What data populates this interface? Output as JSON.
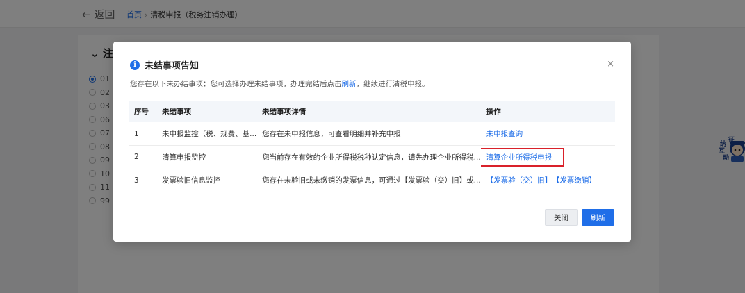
{
  "header": {
    "back_label": "返回",
    "breadcrumb_home": "首页",
    "breadcrumb_current": "清税申报（税务注销办理）"
  },
  "page": {
    "section_title": "注销",
    "radio_items": [
      "01",
      "02",
      "03",
      "06",
      "07",
      "08",
      "09",
      "10",
      "11",
      "99"
    ]
  },
  "mascot": {
    "chars": [
      "征",
      "纳",
      "互",
      "动"
    ]
  },
  "modal": {
    "title": "未结事项告知",
    "close_label": "×",
    "description_prefix": "您存在以下未办结事项：您可选择办理未结事项，办理完结后点击",
    "description_link": "刷新",
    "description_suffix": "，继续进行清税申报。",
    "columns": [
      "序号",
      "未结事项",
      "未结事项详情",
      "操作"
    ],
    "rows": [
      {
        "index": "1",
        "item": "未申报监控（税、规费、基...",
        "detail": "您存在未申报信息，可查看明细并补充申报",
        "actions": [
          "未申报查询"
        ]
      },
      {
        "index": "2",
        "item": "清算申报监控",
        "detail": "您当前存在有效的企业所得税税种认定信息，请先办理企业所得税...",
        "actions": [
          "清算企业所得税申报"
        ]
      },
      {
        "index": "3",
        "item": "发票验旧信息监控",
        "detail": "您存在未验旧或未缴销的发票信息，可通过【发票验（交）旧】或...",
        "actions": [
          "【发票验（交）旧】",
          "【发票缴销】"
        ]
      }
    ],
    "highlight_color": "#d9212a",
    "buttons": {
      "close": "关闭",
      "refresh": "刷新"
    }
  },
  "colors": {
    "accent": "#1f6ee8"
  }
}
